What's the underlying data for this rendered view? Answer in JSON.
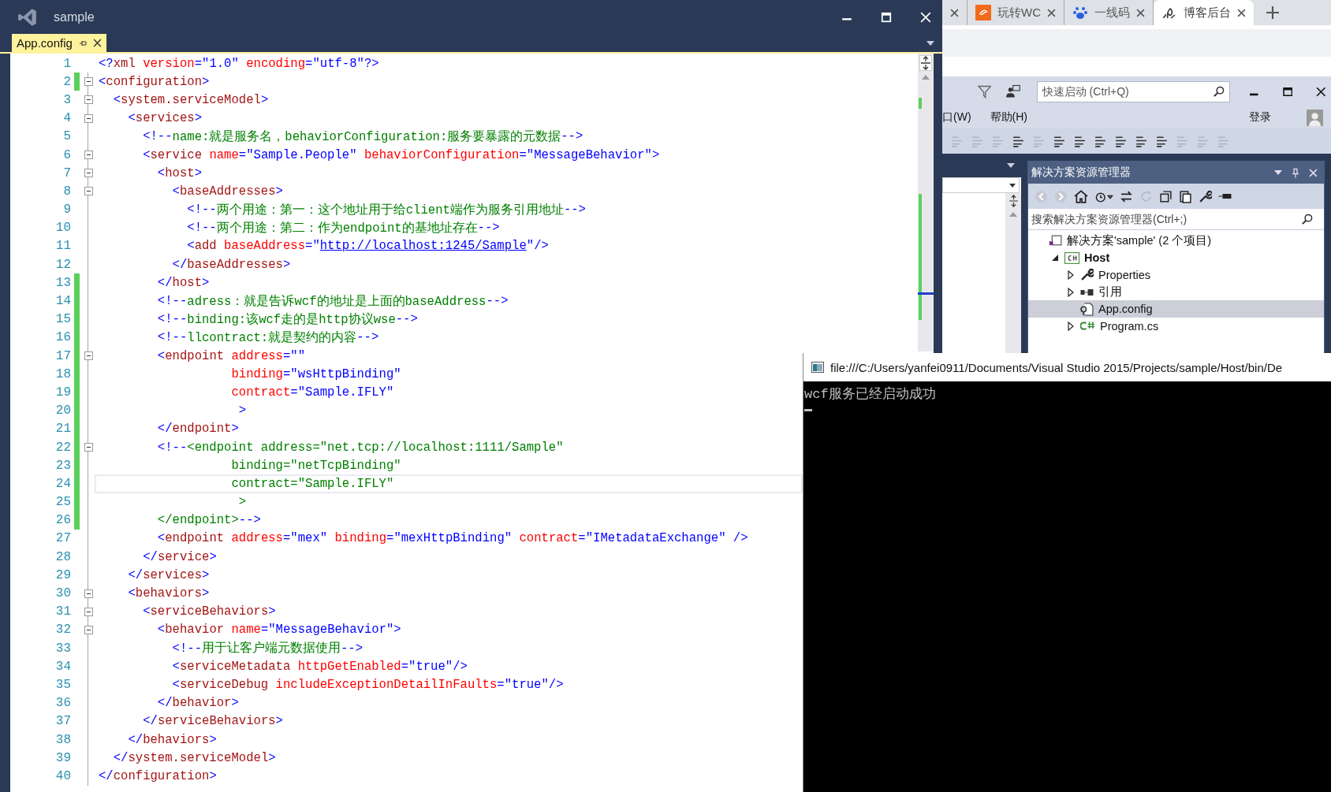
{
  "editor_window": {
    "title": "sample",
    "tabs": [
      {
        "label": "App.config",
        "selected": true
      }
    ]
  },
  "code": {
    "lines": [
      {
        "number": "1",
        "fold": false,
        "changed": false,
        "current": false,
        "tokens": [
          {
            "kind": "punct",
            "text": "<?"
          },
          {
            "kind": "tag",
            "text": "xml"
          },
          {
            "kind": "attr",
            "text": " version"
          },
          {
            "kind": "punct",
            "text": "="
          },
          {
            "kind": "value",
            "text": "\"1.0\""
          },
          {
            "kind": "attr",
            "text": " encoding"
          },
          {
            "kind": "punct",
            "text": "="
          },
          {
            "kind": "value",
            "text": "\"utf-8\""
          },
          {
            "kind": "punct",
            "text": "?>"
          }
        ]
      },
      {
        "number": "2",
        "fold": true,
        "changed": true,
        "current": false,
        "tokens": [
          {
            "kind": "punct",
            "text": "<"
          },
          {
            "kind": "tag",
            "text": "configuration"
          },
          {
            "kind": "punct",
            "text": ">"
          }
        ]
      },
      {
        "number": "3",
        "fold": true,
        "changed": false,
        "current": false,
        "tokens": [
          {
            "kind": "punct",
            "text": "  <"
          },
          {
            "kind": "tag",
            "text": "system.serviceModel"
          },
          {
            "kind": "punct",
            "text": ">"
          }
        ]
      },
      {
        "number": "4",
        "fold": true,
        "changed": false,
        "current": false,
        "tokens": [
          {
            "kind": "punct",
            "text": "    <"
          },
          {
            "kind": "tag",
            "text": "services"
          },
          {
            "kind": "punct",
            "text": ">"
          }
        ]
      },
      {
        "number": "5",
        "fold": false,
        "changed": false,
        "current": false,
        "tokens": [
          {
            "kind": "punct",
            "text": "      <!--"
          },
          {
            "kind": "comment",
            "text": "name:就是服务名，behaviorConfiguration:服务要暴露的元数据"
          },
          {
            "kind": "punct",
            "text": "-->"
          }
        ]
      },
      {
        "number": "6",
        "fold": true,
        "changed": false,
        "current": false,
        "tokens": [
          {
            "kind": "punct",
            "text": "      <"
          },
          {
            "kind": "tag",
            "text": "service"
          },
          {
            "kind": "attr",
            "text": " name"
          },
          {
            "kind": "punct",
            "text": "="
          },
          {
            "kind": "value",
            "text": "\"Sample.People\""
          },
          {
            "kind": "attr",
            "text": " behaviorConfiguration"
          },
          {
            "kind": "punct",
            "text": "="
          },
          {
            "kind": "value",
            "text": "\"MessageBehavior\""
          },
          {
            "kind": "punct",
            "text": ">"
          }
        ]
      },
      {
        "number": "7",
        "fold": true,
        "changed": false,
        "current": false,
        "tokens": [
          {
            "kind": "punct",
            "text": "        <"
          },
          {
            "kind": "tag",
            "text": "host"
          },
          {
            "kind": "punct",
            "text": ">"
          }
        ]
      },
      {
        "number": "8",
        "fold": true,
        "changed": false,
        "current": false,
        "tokens": [
          {
            "kind": "punct",
            "text": "          <"
          },
          {
            "kind": "tag",
            "text": "baseAddresses"
          },
          {
            "kind": "punct",
            "text": ">"
          }
        ]
      },
      {
        "number": "9",
        "fold": false,
        "changed": false,
        "current": false,
        "tokens": [
          {
            "kind": "punct",
            "text": "            <!--"
          },
          {
            "kind": "comment",
            "text": "两个用途：第一：这个地址用于给client端作为服务引用地址"
          },
          {
            "kind": "punct",
            "text": "-->"
          }
        ]
      },
      {
        "number": "10",
        "fold": false,
        "changed": false,
        "current": false,
        "tokens": [
          {
            "kind": "punct",
            "text": "            <!--"
          },
          {
            "kind": "comment",
            "text": "两个用途：第二：作为endpoint的基地址存在"
          },
          {
            "kind": "punct",
            "text": "-->"
          }
        ]
      },
      {
        "number": "11",
        "fold": false,
        "changed": false,
        "current": false,
        "tokens": [
          {
            "kind": "punct",
            "text": "            <"
          },
          {
            "kind": "tag",
            "text": "add"
          },
          {
            "kind": "attr",
            "text": " baseAddress"
          },
          {
            "kind": "punct",
            "text": "="
          },
          {
            "kind": "value",
            "text": "\""
          },
          {
            "kind": "link",
            "text": "http://localhost:1245/Sample"
          },
          {
            "kind": "value",
            "text": "\""
          },
          {
            "kind": "punct",
            "text": "/>"
          }
        ]
      },
      {
        "number": "12",
        "fold": false,
        "changed": false,
        "current": false,
        "tokens": [
          {
            "kind": "punct",
            "text": "          </"
          },
          {
            "kind": "tag",
            "text": "baseAddresses"
          },
          {
            "kind": "punct",
            "text": ">"
          }
        ]
      },
      {
        "number": "13",
        "fold": false,
        "changed": true,
        "current": false,
        "tokens": [
          {
            "kind": "punct",
            "text": "        </"
          },
          {
            "kind": "tag",
            "text": "host"
          },
          {
            "kind": "punct",
            "text": ">"
          }
        ]
      },
      {
        "number": "14",
        "fold": false,
        "changed": true,
        "current": false,
        "tokens": [
          {
            "kind": "punct",
            "text": "        <!--"
          },
          {
            "kind": "comment",
            "text": "adress：就是告诉wcf的地址是上面的baseAddress"
          },
          {
            "kind": "punct",
            "text": "-->"
          }
        ]
      },
      {
        "number": "15",
        "fold": false,
        "changed": true,
        "current": false,
        "tokens": [
          {
            "kind": "punct",
            "text": "        <!--"
          },
          {
            "kind": "comment",
            "text": "binding:该wcf走的是http协议wse"
          },
          {
            "kind": "punct",
            "text": "-->"
          }
        ]
      },
      {
        "number": "16",
        "fold": false,
        "changed": true,
        "current": false,
        "tokens": [
          {
            "kind": "punct",
            "text": "        <!--"
          },
          {
            "kind": "comment",
            "text": "llcontract:就是契约的内容"
          },
          {
            "kind": "punct",
            "text": "-->"
          }
        ]
      },
      {
        "number": "17",
        "fold": true,
        "changed": true,
        "current": false,
        "tokens": [
          {
            "kind": "punct",
            "text": "        <"
          },
          {
            "kind": "tag",
            "text": "endpoint"
          },
          {
            "kind": "attr",
            "text": " address"
          },
          {
            "kind": "punct",
            "text": "="
          },
          {
            "kind": "value",
            "text": "\"\""
          }
        ]
      },
      {
        "number": "18",
        "fold": false,
        "changed": true,
        "current": false,
        "tokens": [
          {
            "kind": "attr",
            "text": "                  binding"
          },
          {
            "kind": "punct",
            "text": "="
          },
          {
            "kind": "value",
            "text": "\"wsHttpBinding\""
          }
        ]
      },
      {
        "number": "19",
        "fold": false,
        "changed": true,
        "current": false,
        "tokens": [
          {
            "kind": "attr",
            "text": "                  contract"
          },
          {
            "kind": "punct",
            "text": "="
          },
          {
            "kind": "value",
            "text": "\"Sample.IFLY\""
          }
        ]
      },
      {
        "number": "20",
        "fold": false,
        "changed": true,
        "current": false,
        "tokens": [
          {
            "kind": "punct",
            "text": "                   >"
          }
        ]
      },
      {
        "number": "21",
        "fold": false,
        "changed": true,
        "current": false,
        "tokens": [
          {
            "kind": "punct",
            "text": "        </"
          },
          {
            "kind": "tag",
            "text": "endpoint"
          },
          {
            "kind": "punct",
            "text": ">"
          }
        ]
      },
      {
        "number": "22",
        "fold": true,
        "changed": true,
        "current": false,
        "tokens": [
          {
            "kind": "punct",
            "text": "        <!--"
          },
          {
            "kind": "comment",
            "text": "<endpoint address=\"net.tcp://localhost:1111/Sample\""
          }
        ]
      },
      {
        "number": "23",
        "fold": false,
        "changed": true,
        "current": false,
        "tokens": [
          {
            "kind": "comment",
            "text": "                  binding=\"netTcpBinding\""
          }
        ]
      },
      {
        "number": "24",
        "fold": false,
        "changed": true,
        "current": true,
        "tokens": [
          {
            "kind": "comment",
            "text": "                  contract=\"Sample.IFLY\""
          }
        ]
      },
      {
        "number": "25",
        "fold": false,
        "changed": true,
        "current": false,
        "tokens": [
          {
            "kind": "comment",
            "text": "                   >"
          }
        ]
      },
      {
        "number": "26",
        "fold": false,
        "changed": true,
        "current": false,
        "tokens": [
          {
            "kind": "comment",
            "text": "        </endpoint>"
          },
          {
            "kind": "punct",
            "text": "-->"
          }
        ]
      },
      {
        "number": "27",
        "fold": false,
        "changed": false,
        "current": false,
        "tokens": [
          {
            "kind": "punct",
            "text": "        <"
          },
          {
            "kind": "tag",
            "text": "endpoint"
          },
          {
            "kind": "attr",
            "text": " address"
          },
          {
            "kind": "punct",
            "text": "="
          },
          {
            "kind": "value",
            "text": "\"mex\""
          },
          {
            "kind": "attr",
            "text": " binding"
          },
          {
            "kind": "punct",
            "text": "="
          },
          {
            "kind": "value",
            "text": "\"mexHttpBinding\""
          },
          {
            "kind": "attr",
            "text": " contract"
          },
          {
            "kind": "punct",
            "text": "="
          },
          {
            "kind": "value",
            "text": "\"IMetadataExchange\""
          },
          {
            "kind": "punct",
            "text": " />"
          }
        ]
      },
      {
        "number": "28",
        "fold": false,
        "changed": false,
        "current": false,
        "tokens": [
          {
            "kind": "punct",
            "text": "      </"
          },
          {
            "kind": "tag",
            "text": "service"
          },
          {
            "kind": "punct",
            "text": ">"
          }
        ]
      },
      {
        "number": "29",
        "fold": false,
        "changed": false,
        "current": false,
        "tokens": [
          {
            "kind": "punct",
            "text": "    </"
          },
          {
            "kind": "tag",
            "text": "services"
          },
          {
            "kind": "punct",
            "text": ">"
          }
        ]
      },
      {
        "number": "30",
        "fold": true,
        "changed": false,
        "current": false,
        "tokens": [
          {
            "kind": "punct",
            "text": "    <"
          },
          {
            "kind": "tag",
            "text": "behaviors"
          },
          {
            "kind": "punct",
            "text": ">"
          }
        ]
      },
      {
        "number": "31",
        "fold": true,
        "changed": false,
        "current": false,
        "tokens": [
          {
            "kind": "punct",
            "text": "      <"
          },
          {
            "kind": "tag",
            "text": "serviceBehaviors"
          },
          {
            "kind": "punct",
            "text": ">"
          }
        ]
      },
      {
        "number": "32",
        "fold": true,
        "changed": false,
        "current": false,
        "tokens": [
          {
            "kind": "punct",
            "text": "        <"
          },
          {
            "kind": "tag",
            "text": "behavior"
          },
          {
            "kind": "attr",
            "text": " name"
          },
          {
            "kind": "punct",
            "text": "="
          },
          {
            "kind": "value",
            "text": "\"MessageBehavior\""
          },
          {
            "kind": "punct",
            "text": ">"
          }
        ]
      },
      {
        "number": "33",
        "fold": false,
        "changed": false,
        "current": false,
        "tokens": [
          {
            "kind": "punct",
            "text": "          <!--"
          },
          {
            "kind": "comment",
            "text": "用于让客户端元数据使用"
          },
          {
            "kind": "punct",
            "text": "-->"
          }
        ]
      },
      {
        "number": "34",
        "fold": false,
        "changed": false,
        "current": false,
        "tokens": [
          {
            "kind": "punct",
            "text": "          <"
          },
          {
            "kind": "tag",
            "text": "serviceMetadata"
          },
          {
            "kind": "attr",
            "text": " httpGetEnabled"
          },
          {
            "kind": "punct",
            "text": "="
          },
          {
            "kind": "value",
            "text": "\"true\""
          },
          {
            "kind": "punct",
            "text": "/>"
          }
        ]
      },
      {
        "number": "35",
        "fold": false,
        "changed": false,
        "current": false,
        "tokens": [
          {
            "kind": "punct",
            "text": "          <"
          },
          {
            "kind": "tag",
            "text": "serviceDebug"
          },
          {
            "kind": "attr",
            "text": " includeExceptionDetailInFaults"
          },
          {
            "kind": "punct",
            "text": "="
          },
          {
            "kind": "value",
            "text": "\"true\""
          },
          {
            "kind": "punct",
            "text": "/>"
          }
        ]
      },
      {
        "number": "36",
        "fold": false,
        "changed": false,
        "current": false,
        "tokens": [
          {
            "kind": "punct",
            "text": "        </"
          },
          {
            "kind": "tag",
            "text": "behavior"
          },
          {
            "kind": "punct",
            "text": ">"
          }
        ]
      },
      {
        "number": "37",
        "fold": false,
        "changed": false,
        "current": false,
        "tokens": [
          {
            "kind": "punct",
            "text": "      </"
          },
          {
            "kind": "tag",
            "text": "serviceBehaviors"
          },
          {
            "kind": "punct",
            "text": ">"
          }
        ]
      },
      {
        "number": "38",
        "fold": false,
        "changed": false,
        "current": false,
        "tokens": [
          {
            "kind": "punct",
            "text": "    </"
          },
          {
            "kind": "tag",
            "text": "behaviors"
          },
          {
            "kind": "punct",
            "text": ">"
          }
        ]
      },
      {
        "number": "39",
        "fold": false,
        "changed": false,
        "current": false,
        "tokens": [
          {
            "kind": "punct",
            "text": "  </"
          },
          {
            "kind": "tag",
            "text": "system.serviceModel"
          },
          {
            "kind": "punct",
            "text": ">"
          }
        ]
      },
      {
        "number": "40",
        "fold": false,
        "changed": false,
        "current": false,
        "tokens": [
          {
            "kind": "punct",
            "text": "</"
          },
          {
            "kind": "tag",
            "text": "configuration"
          },
          {
            "kind": "punct",
            "text": ">"
          }
        ]
      }
    ]
  },
  "browser": {
    "tabs": [
      {
        "kind": "none",
        "selected": false
      },
      {
        "title": "玩转WC",
        "kind": "tile",
        "selected": false
      },
      {
        "title": "一线码",
        "kind": "paw",
        "selected": false
      },
      {
        "title": "博客后台",
        "kind": "sketch",
        "selected": true
      }
    ]
  },
  "ide_window": {
    "quick_launch": {
      "placeholder": "快速启动 (Ctrl+Q)"
    },
    "menu": [
      "口(W)",
      "帮助(H)"
    ],
    "sign_in": "登录"
  },
  "solution_explorer": {
    "title": "解决方案资源管理器",
    "search": {
      "placeholder": "搜索解决方案资源管理器(Ctrl+;)"
    },
    "tree": [
      {
        "label": "解决方案'sample' (2 个项目)",
        "kind": "solution",
        "startup": false,
        "selected": false,
        "children": [
          {
            "label": "Host",
            "kind": "project",
            "expanded": true,
            "startup": true,
            "selected": false,
            "children": [
              {
                "label": "Properties",
                "kind": "wrench",
                "expanded": false,
                "startup": false,
                "selected": false
              },
              {
                "label": "引用",
                "kind": "references",
                "expanded": false,
                "startup": false,
                "selected": false
              },
              {
                "label": "App.config",
                "kind": "config",
                "startup": false,
                "selected": true
              },
              {
                "label": "Program.cs",
                "kind": "csharp",
                "expanded": false,
                "startup": false,
                "selected": false
              }
            ]
          }
        ]
      }
    ]
  },
  "console": {
    "title": "file:///C:/Users/yanfei0911/Documents/Visual Studio 2015/Projects/sample/Host/bin/De",
    "lines": [
      "wcf服务已经启动成功"
    ]
  }
}
